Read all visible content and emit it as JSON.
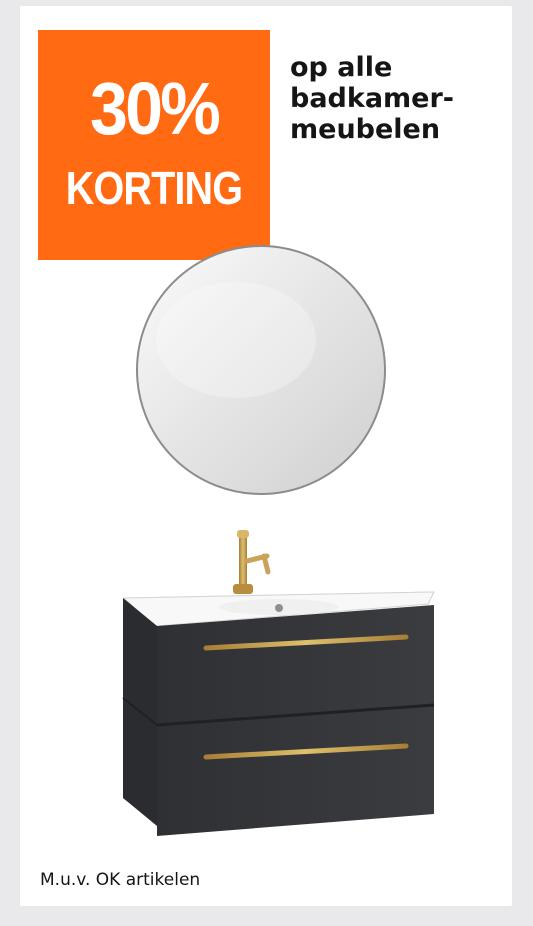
{
  "discount": {
    "percent": "30%",
    "word": "KORTING",
    "background_color": "#ff6a13"
  },
  "headline": {
    "lines": [
      "op alle",
      "badkamer-",
      "meubelen"
    ]
  },
  "footnote": "M.u.v. OK artikelen",
  "illustration": {
    "subject_icons": [
      "round-mirror-icon",
      "gold-faucet-icon",
      "vanity-cabinet-icon"
    ],
    "cabinet_color": "#343538",
    "handle_color": "#c8a24a",
    "faucet_color": "#c9a35a"
  }
}
